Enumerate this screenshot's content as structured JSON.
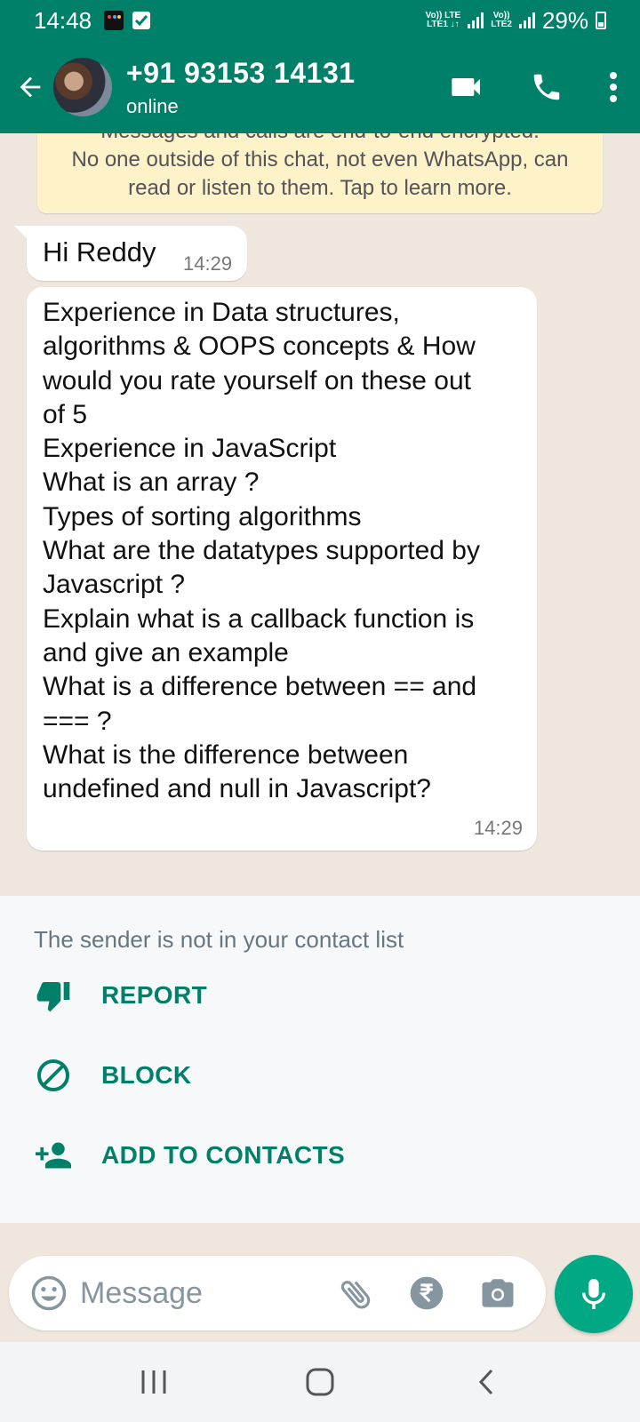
{
  "status_bar": {
    "time": "14:48",
    "network1": "Vo)) LTE\nLTE1",
    "network2": "Vo))\nLTE2",
    "battery": "29%"
  },
  "header": {
    "contact_name": "+91 93153 14131",
    "status": "online",
    "accent": "#008069"
  },
  "encryption_notice": {
    "line_partial": "Messages and calls are end-to-end encrypted.",
    "line2": "No one outside of this chat, not even WhatsApp, can",
    "line3": "read or listen to them. Tap to learn more."
  },
  "messages": [
    {
      "text": "Hi Reddy",
      "time": "14:29"
    },
    {
      "text": "Experience in Data structures,\nalgorithms & OOPS concepts & How\nwould you rate yourself on these out\nof 5\nExperience in JavaScript\nWhat is an array ?\nTypes of sorting algorithms\nWhat are the datatypes supported by\nJavascript ?\nExplain what is a callback function is\nand give an example\nWhat is a difference between == and\n=== ?\nWhat is the difference between\nundefined and null in Javascript?",
      "time": "14:29"
    }
  ],
  "unknown_sender": {
    "notice": "The sender is not in your contact list",
    "actions": [
      {
        "label": "REPORT",
        "icon": "thumbs-down-icon"
      },
      {
        "label": "BLOCK",
        "icon": "block-icon"
      },
      {
        "label": "ADD TO CONTACTS",
        "icon": "add-person-icon"
      }
    ]
  },
  "composer": {
    "placeholder": "Message",
    "mic_color": "#00A884"
  }
}
